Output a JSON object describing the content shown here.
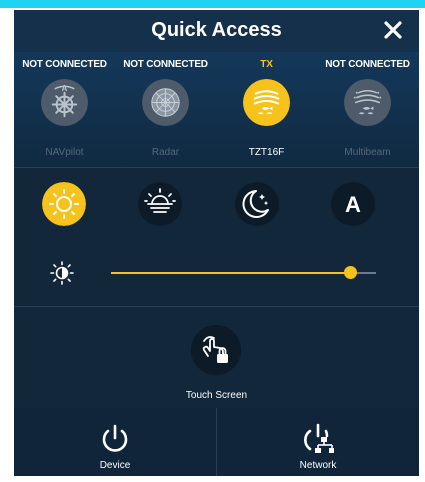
{
  "header": {
    "title": "Quick Access"
  },
  "sources": [
    {
      "status": "NOT CONNECTED",
      "name": "NAVpilot",
      "active": false
    },
    {
      "status": "NOT CONNECTED",
      "name": "Radar",
      "active": false
    },
    {
      "status": "TX",
      "name": "TZT16F",
      "active": true
    },
    {
      "status": "NOT CONNECTED",
      "name": "Multibeam",
      "active": false
    }
  ],
  "display_modes": [
    "day",
    "dusk",
    "night",
    "auto"
  ],
  "display_mode_auto_letter": "A",
  "selected_display_mode": "day",
  "brightness": {
    "level": 0.9
  },
  "touch_screen": {
    "label": "Touch Screen"
  },
  "bottom": {
    "device_label": "Device",
    "network_label": "Network"
  },
  "colors": {
    "accent": "#f6c21c",
    "panel": "#13273b",
    "header": "#15304b",
    "cyan": "#1fd4f2"
  },
  "icons": {
    "close": "close-icon",
    "navpilot": "ship-wheel-icon",
    "radar": "radar-icon",
    "sounder": "fish-finder-icon",
    "multibeam": "multibeam-icon",
    "day": "sun-icon",
    "dusk": "sunset-icon",
    "night": "moon-stars-icon",
    "brightness": "brightness-icon",
    "touch": "touch-lock-icon",
    "device": "power-icon",
    "network": "network-power-icon"
  }
}
